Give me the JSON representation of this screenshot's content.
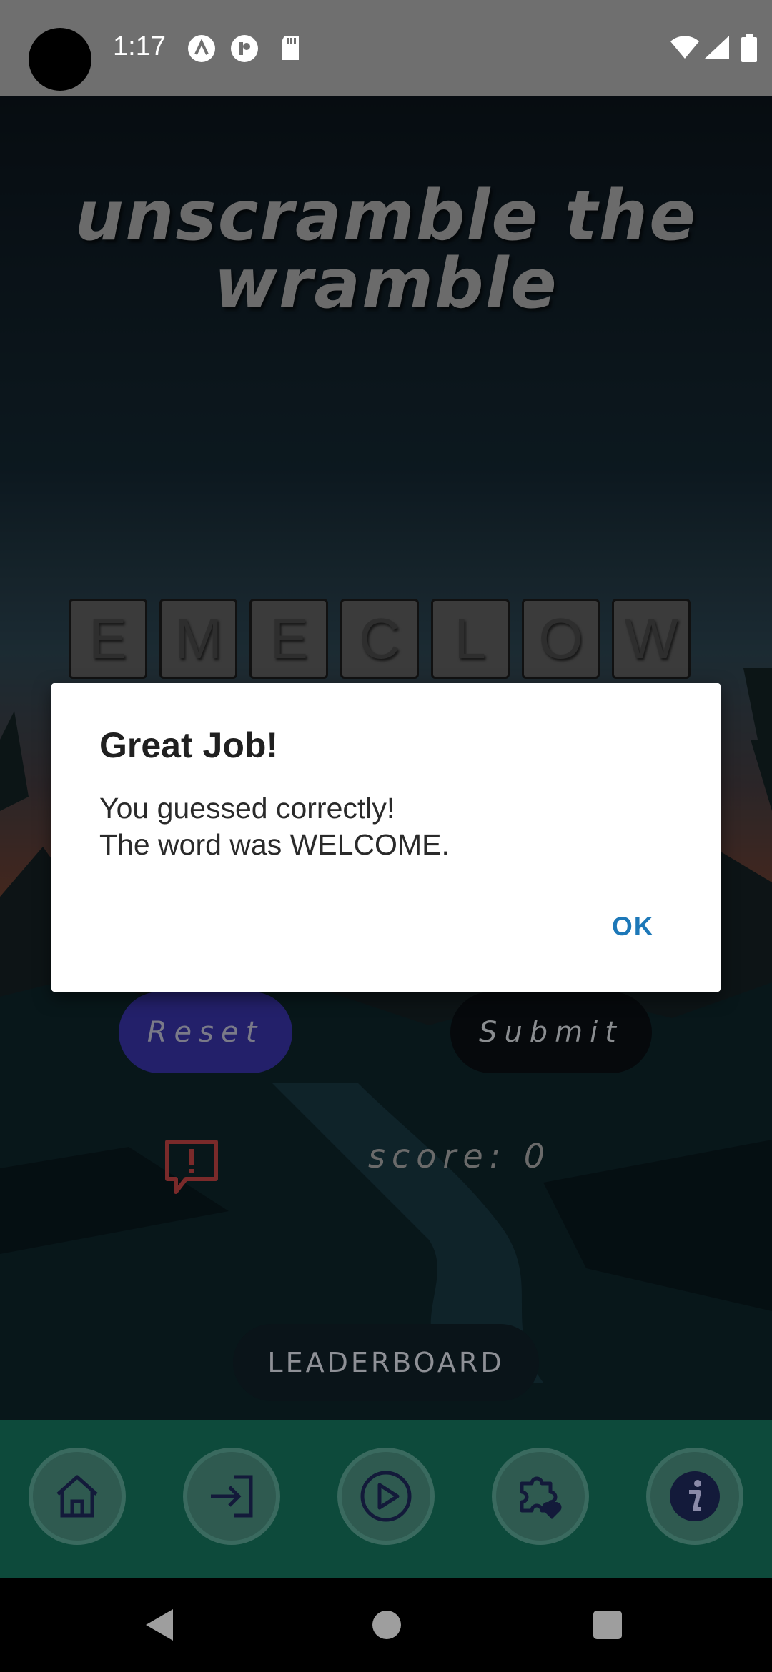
{
  "status_bar": {
    "time": "1:17"
  },
  "game": {
    "title_line1": "unscramble the",
    "title_line2": "wramble",
    "letters": [
      "E",
      "M",
      "E",
      "C",
      "L",
      "O",
      "W"
    ],
    "reset_label": "Reset",
    "submit_label": "Submit",
    "score_text": "score: 0",
    "leaderboard_label": "LEADERBOARD"
  },
  "dialog": {
    "title": "Great Job!",
    "message_line1": "You guessed correctly!",
    "message_line2": "The word was WELCOME.",
    "ok_label": "OK"
  },
  "bottom_nav": {
    "items": [
      {
        "icon": "home-icon"
      },
      {
        "icon": "login-icon"
      },
      {
        "icon": "play-icon"
      },
      {
        "icon": "puzzle-heart-icon"
      },
      {
        "icon": "info-icon"
      }
    ]
  },
  "colors": {
    "nav_background": "#0d4a3b",
    "dialog_accent": "#1d78b8",
    "reset_button": "#23206a"
  }
}
